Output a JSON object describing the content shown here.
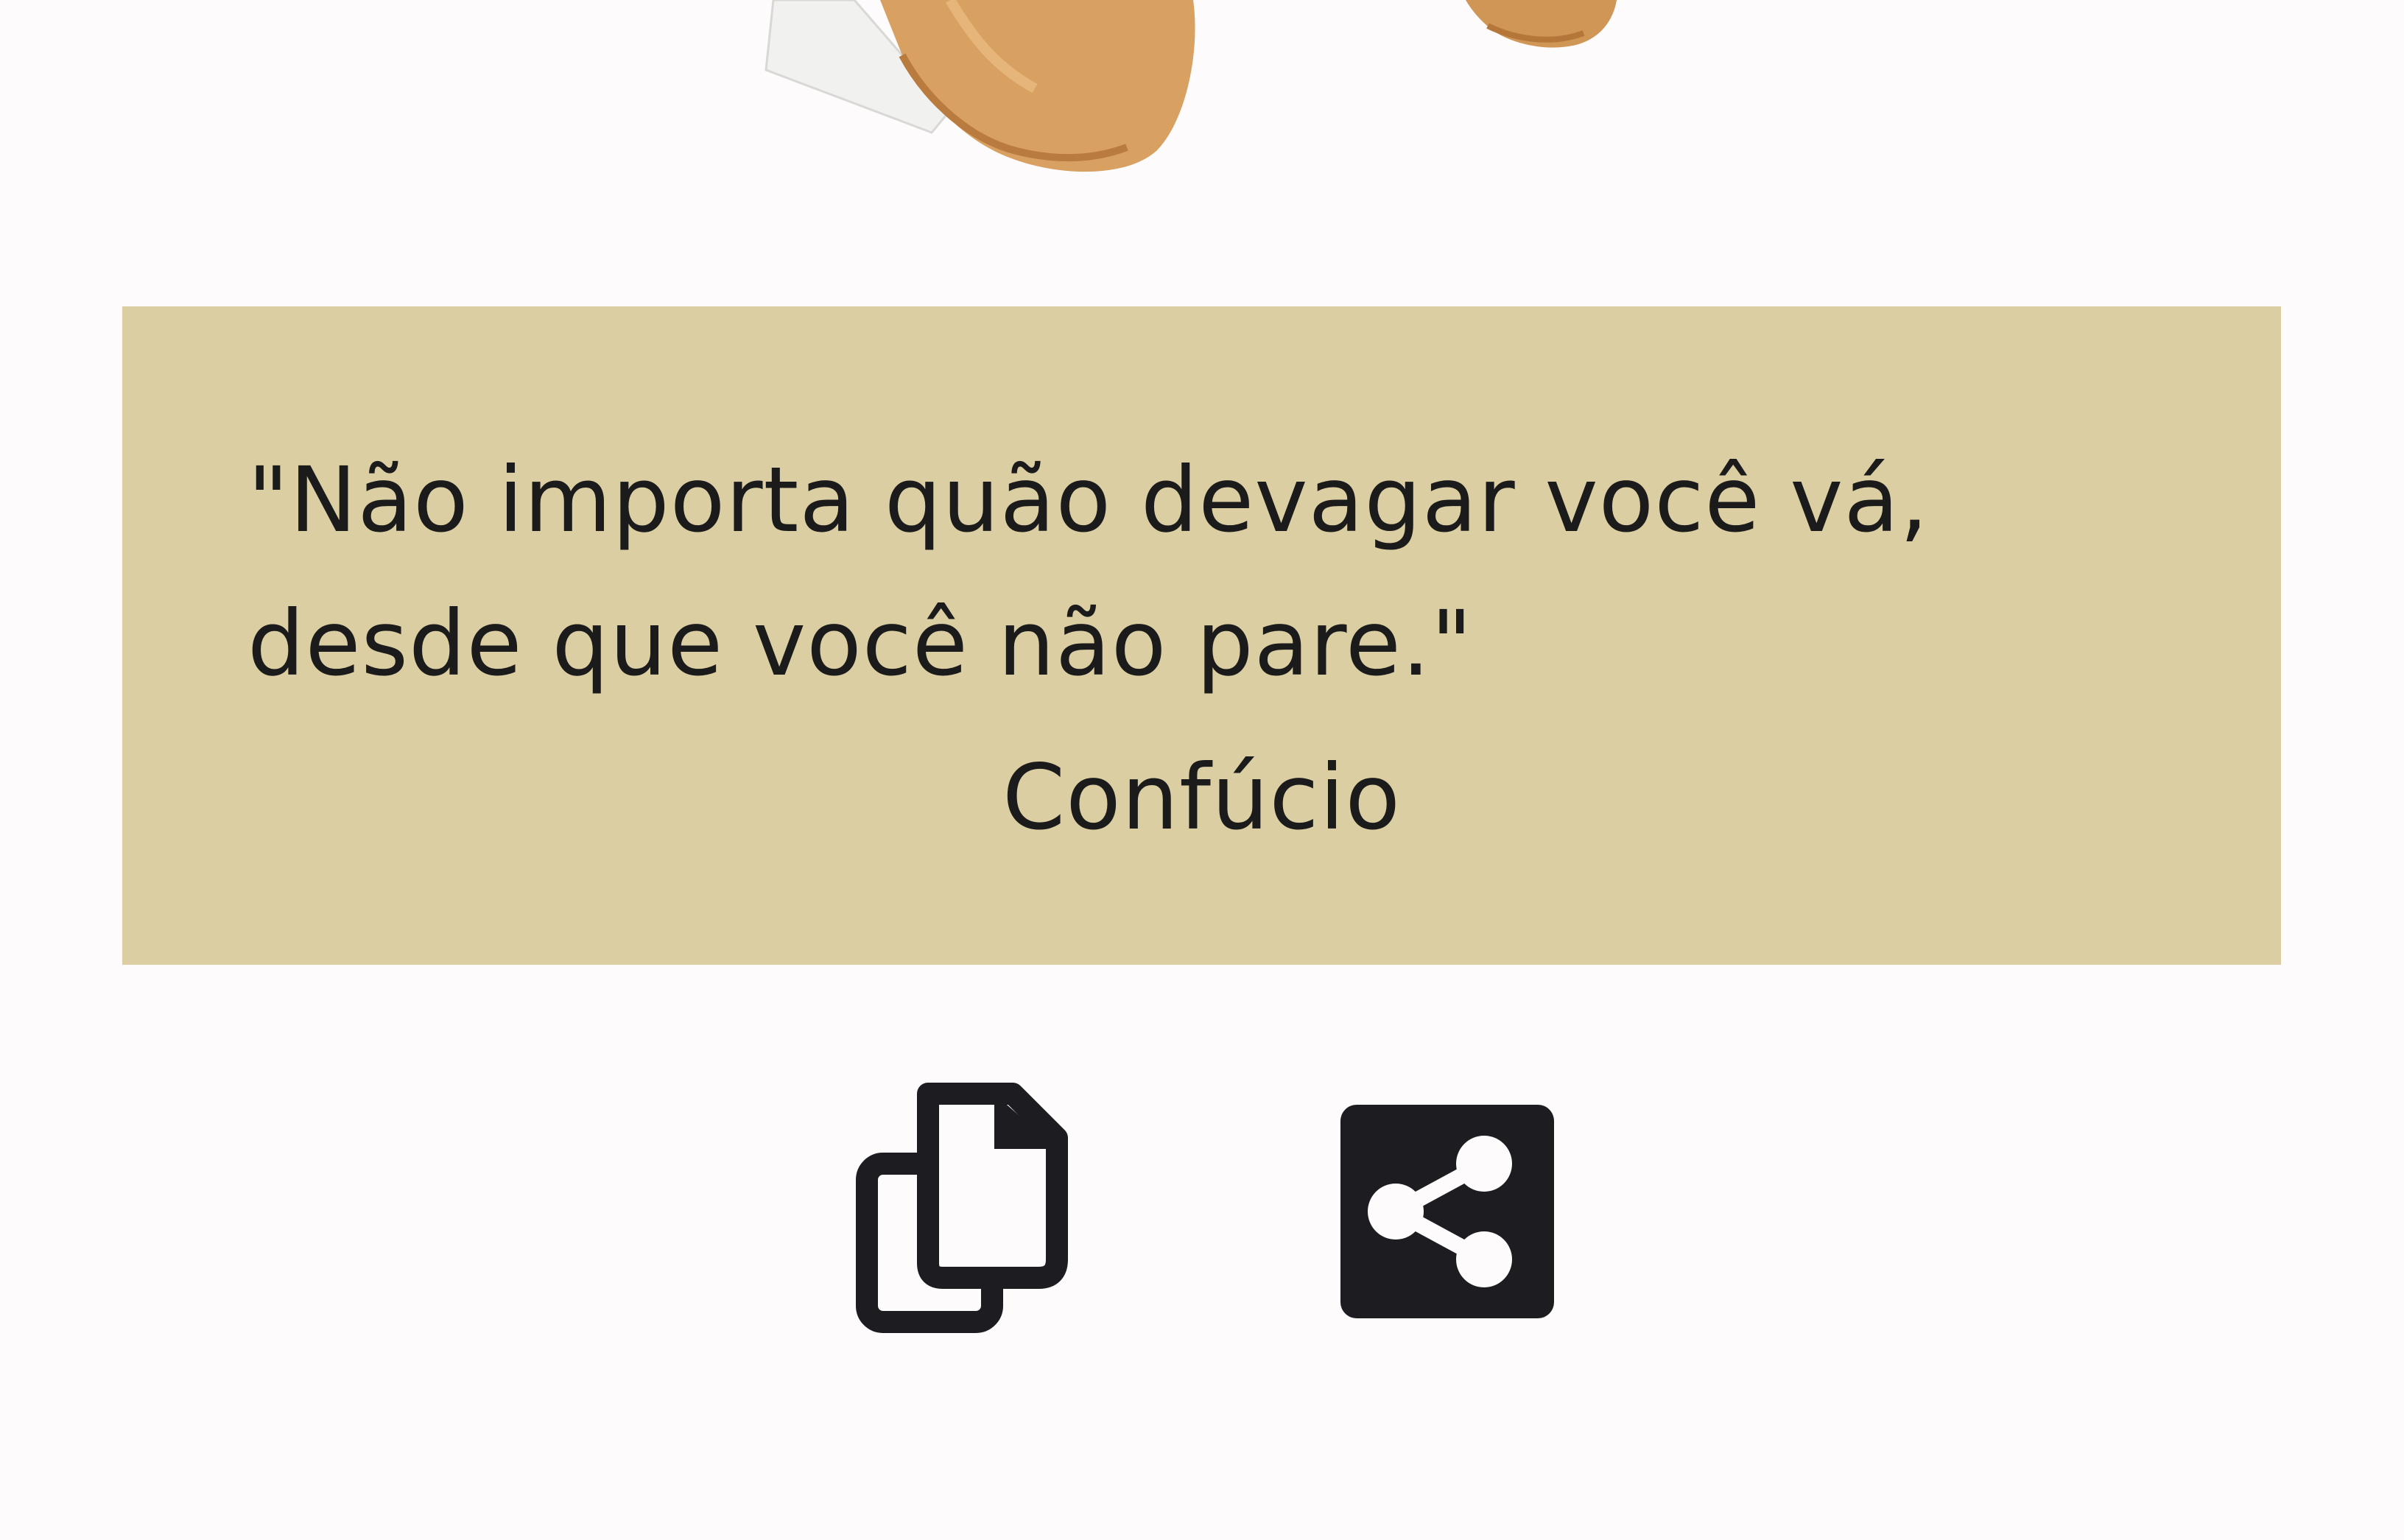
{
  "quote": {
    "text": "\"Não importa quão devagar você vá,\ndesde que você não pare.\"",
    "author": "Confúcio"
  },
  "actions": {
    "copy_icon": "copy-icon",
    "share_icon": "share-icon"
  },
  "colors": {
    "background": "#fdfbfc",
    "card": "#dacea2",
    "icon": "#1d1c21",
    "text": "#1b1b1b"
  }
}
